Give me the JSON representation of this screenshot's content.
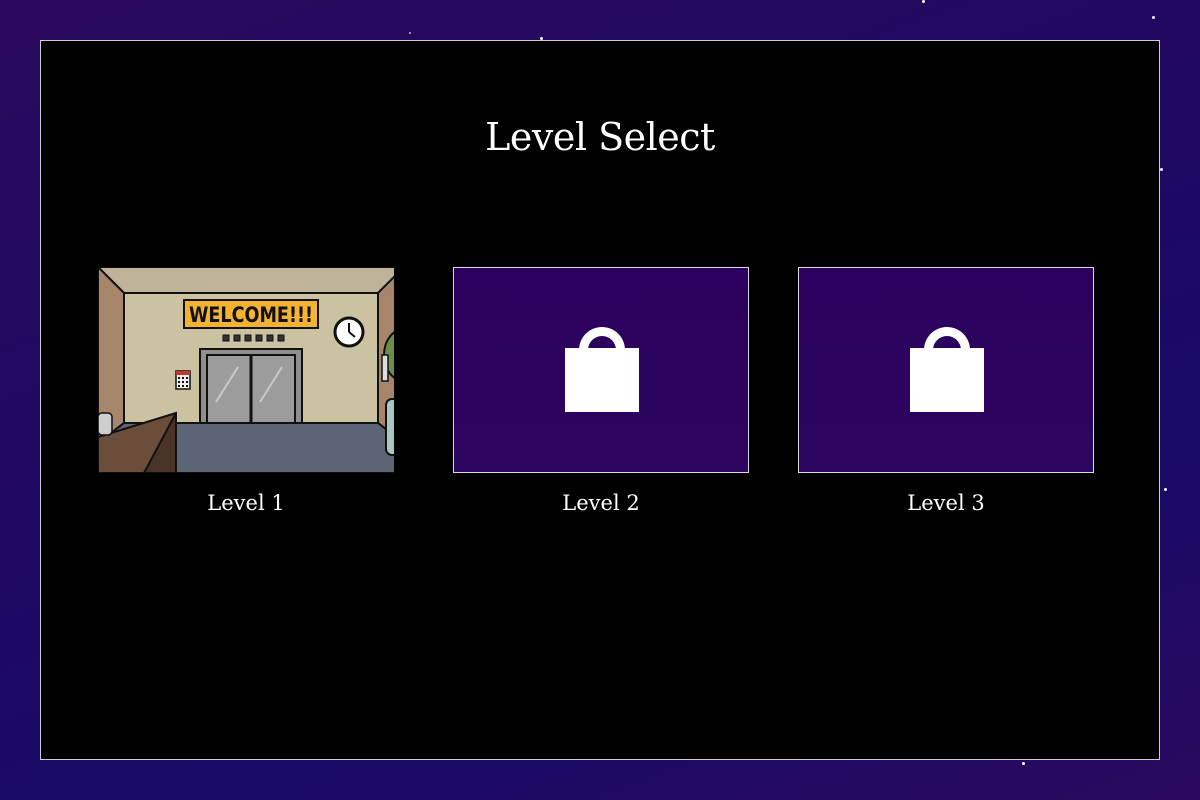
{
  "screen": {
    "title": "Level Select"
  },
  "levels": [
    {
      "label": "Level 1",
      "locked": false,
      "preview_sign_text": "WELCOME!!!"
    },
    {
      "label": "Level 2",
      "locked": true
    },
    {
      "label": "Level 3",
      "locked": true
    }
  ],
  "colors": {
    "background": "#1e0862",
    "panel": "#000000",
    "locked_tile": "#2b005e",
    "text": "#ffffff"
  },
  "icons": {
    "lock": "lock-icon"
  }
}
